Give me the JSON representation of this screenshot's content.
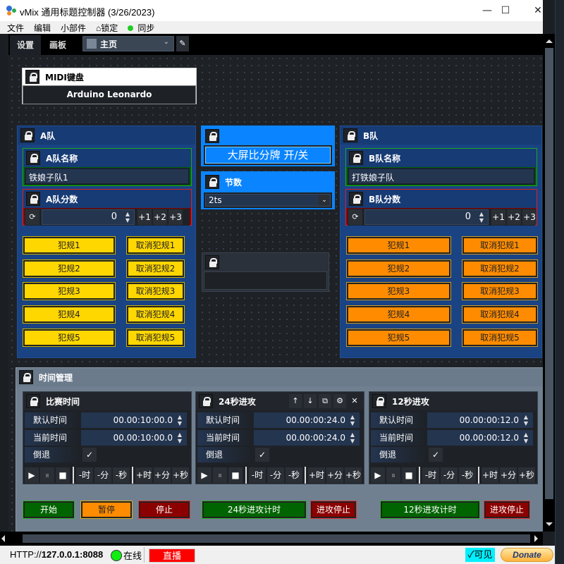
{
  "window": {
    "title": "vMix 通用标题控制器 (3/26/2023)",
    "minimize": "—",
    "maximize": "☐",
    "close": "✕"
  },
  "menu": {
    "file": "文件",
    "edit": "编辑",
    "widgets": "小部件",
    "lock": "锁定",
    "sync": "同步"
  },
  "tabs": {
    "settings": "设置",
    "canvas": "画板",
    "page": "主页",
    "page_chevron": "⌄",
    "edit_icon": "✎"
  },
  "midi": {
    "title": "MIDI键盘",
    "device": "Arduino Leonardo"
  },
  "teamA": {
    "title": "A队",
    "name_title": "A队名称",
    "name_value": "铁娘子队1",
    "score_title": "A队分数",
    "score_value": "0",
    "increments": [
      "+1",
      "+2",
      "+3"
    ],
    "fouls": [
      "犯规1",
      "犯规2",
      "犯规3",
      "犯规4",
      "犯规5"
    ],
    "cancel_fouls": [
      "取消犯规1",
      "取消犯规2",
      "取消犯规3",
      "取消犯规4",
      "取消犯规5"
    ]
  },
  "teamB": {
    "title": "B队",
    "name_title": "B队名称",
    "name_value": "打铁娘子队",
    "score_title": "B队分数",
    "score_value": "0",
    "increments": [
      "+1",
      "+2",
      "+3"
    ],
    "fouls": [
      "犯规1",
      "犯规2",
      "犯规3",
      "犯规4",
      "犯规5"
    ],
    "cancel_fouls": [
      "取消犯规1",
      "取消犯规2",
      "取消犯规3",
      "取消犯规4",
      "取消犯规5"
    ]
  },
  "center": {
    "scoreboard_toggle": "大屏比分牌 开/关",
    "period_title": "节数",
    "period_value": "2ts"
  },
  "time": {
    "title": "时间管理",
    "labels": {
      "default": "默认时间",
      "current": "当前时间",
      "countdown": "倒退",
      "check": "✓"
    },
    "controls": [
      "▶",
      "⏸",
      "■",
      "-时",
      "-分",
      "-秒",
      "+时",
      "+分",
      "+秒"
    ],
    "timers": [
      {
        "title": "比赛时间",
        "default": "00.00:10:00.0",
        "current": "00.00:10:00.0"
      },
      {
        "title": "24秒进攻",
        "default": "00.00:00:24.0",
        "current": "00.00:00:24.0"
      },
      {
        "title": "12秒进攻",
        "default": "00.00:00:12.0",
        "current": "00.00:00:12.0"
      }
    ],
    "header_buttons": [
      "↑",
      "↓",
      "⧉",
      "⚙",
      "✕"
    ],
    "actions": {
      "start": "开始",
      "pause": "暂停",
      "stop": "停止",
      "shot24": "24秒进攻计时",
      "stop24": "进攻停止",
      "shot12": "12秒进攻计时",
      "stop12": "进攻停止"
    }
  },
  "status": {
    "url_prefix": "HTTP://",
    "url_host": "127.0.0.1:8088",
    "online": "在线",
    "live": "直播",
    "visible": "✓可见",
    "donate": "Donate"
  },
  "colors": {
    "teamPanel": "#1a4384",
    "nameGreen": "#006400",
    "scoreRed": "#8b0000",
    "foulYellow": "#ffd700",
    "foulOrange": "#ff8c00",
    "accentBlue": "#0a84ff",
    "live": "#ff0000",
    "visible": "#00f0ff"
  }
}
